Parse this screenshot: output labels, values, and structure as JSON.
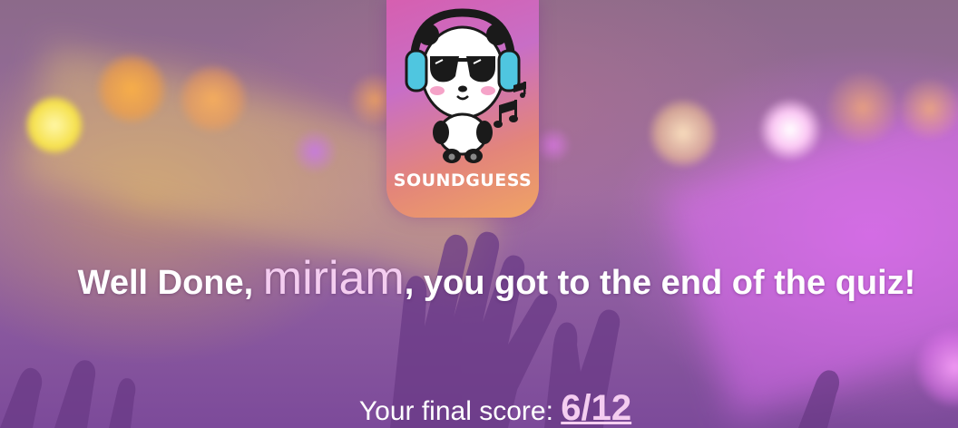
{
  "logo": {
    "wordmark": "SOUNDGUESS",
    "icon": "panda-headphones-icon",
    "note_icon": "music-note-icon"
  },
  "result": {
    "greeting_prefix": "Well Done, ",
    "player_name": "miriam",
    "greeting_suffix": ", you got to the end of the quiz!",
    "score_label": "Your final score: ",
    "score_value": "6/12"
  },
  "colors": {
    "accent_pink": "#f4cdf0",
    "card_pink": "#d65fb0",
    "card_orange": "#f0a464",
    "text_white": "#ffffff"
  }
}
